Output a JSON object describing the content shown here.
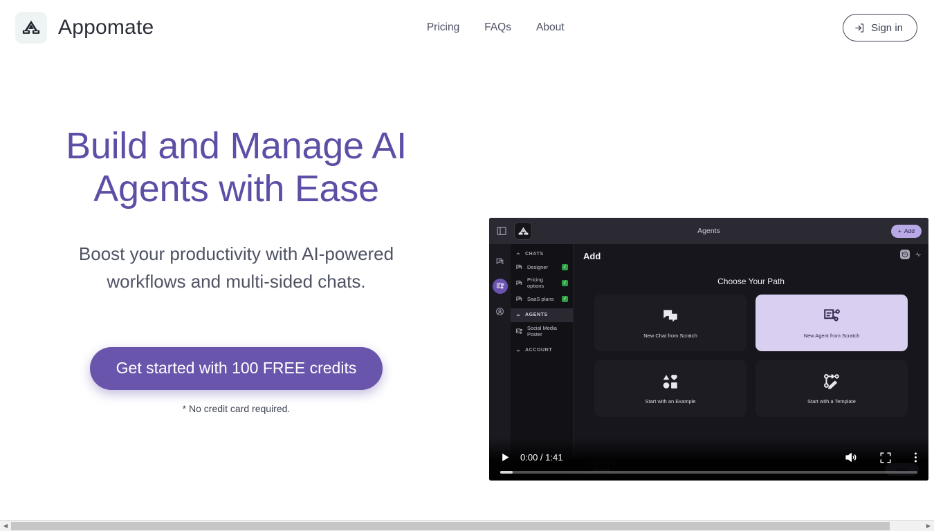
{
  "header": {
    "brand_name": "Appomate",
    "logo_icon": "appomate-logo-icon",
    "nav": [
      {
        "label": "Pricing"
      },
      {
        "label": "FAQs"
      },
      {
        "label": "About"
      }
    ],
    "signin": {
      "label": "Sign in",
      "icon": "login-arrow-icon"
    }
  },
  "hero": {
    "headline": "Build and Manage AI Agents with Ease",
    "subhead": "Boost your productivity with AI-powered workflows and multi-sided chats.",
    "cta_label": "Get started with 100 FREE credits",
    "cta_note": "* No credit card required.",
    "headline_color": "#5b4fa6",
    "cta_color": "#6a55ac"
  },
  "video": {
    "time_current": "0:00",
    "time_total": "1:41",
    "time_label": "0:00 / 1:41",
    "progress_percent": 3,
    "controls": {
      "play": "play-icon",
      "volume": "volume-icon",
      "fullscreen": "fullscreen-icon",
      "more": "more-options-icon"
    },
    "app": {
      "topbar": {
        "panel_toggle_icon": "panel-toggle-icon",
        "logo_icon": "appomate-logo-icon",
        "title": "Agents",
        "add_label": "Add",
        "add_icon": "plus-icon"
      },
      "rail": [
        {
          "name": "chats-rail-icon",
          "active": false
        },
        {
          "name": "agents-rail-icon",
          "active": true
        },
        {
          "name": "account-rail-icon",
          "active": false
        }
      ],
      "sidebar": {
        "sections": [
          {
            "label": "CHATS",
            "chevron": "chevron-up-icon",
            "highlight": false,
            "items": [
              {
                "label": "Designer",
                "icon": "chat-icon",
                "checked": true
              },
              {
                "label": "Pricing options",
                "icon": "chat-icon",
                "checked": true
              },
              {
                "label": "SaaS plans",
                "icon": "chat-icon",
                "checked": true
              }
            ]
          },
          {
            "label": "AGENTS",
            "chevron": "chevron-up-icon",
            "highlight": true,
            "items": [
              {
                "label": "Social Media Poster",
                "icon": "agent-icon",
                "checked": false
              }
            ]
          },
          {
            "label": "ACCOUNT",
            "chevron": "chevron-down-icon",
            "highlight": false,
            "items": []
          }
        ]
      },
      "main": {
        "heading": "Add",
        "corner_icons": [
          "history-icon",
          "activity-icon"
        ],
        "choose_title": "Choose Your Path",
        "cards": [
          {
            "label": "New Chat from Scratch",
            "icon": "chat-bubbles-icon",
            "selected": false
          },
          {
            "label": "New Agent from Scratch",
            "icon": "agent-flow-icon",
            "selected": true
          },
          {
            "label": "Start with an Example",
            "icon": "shapes-icon",
            "selected": false
          },
          {
            "label": "Start with a Template",
            "icon": "template-edit-icon",
            "selected": false
          }
        ],
        "cancel_label": "Cancel",
        "next_label": "Next"
      }
    }
  },
  "scrollbar": {
    "left_arrow_icon": "scroll-left-icon",
    "right_arrow_icon": "scroll-right-icon"
  }
}
